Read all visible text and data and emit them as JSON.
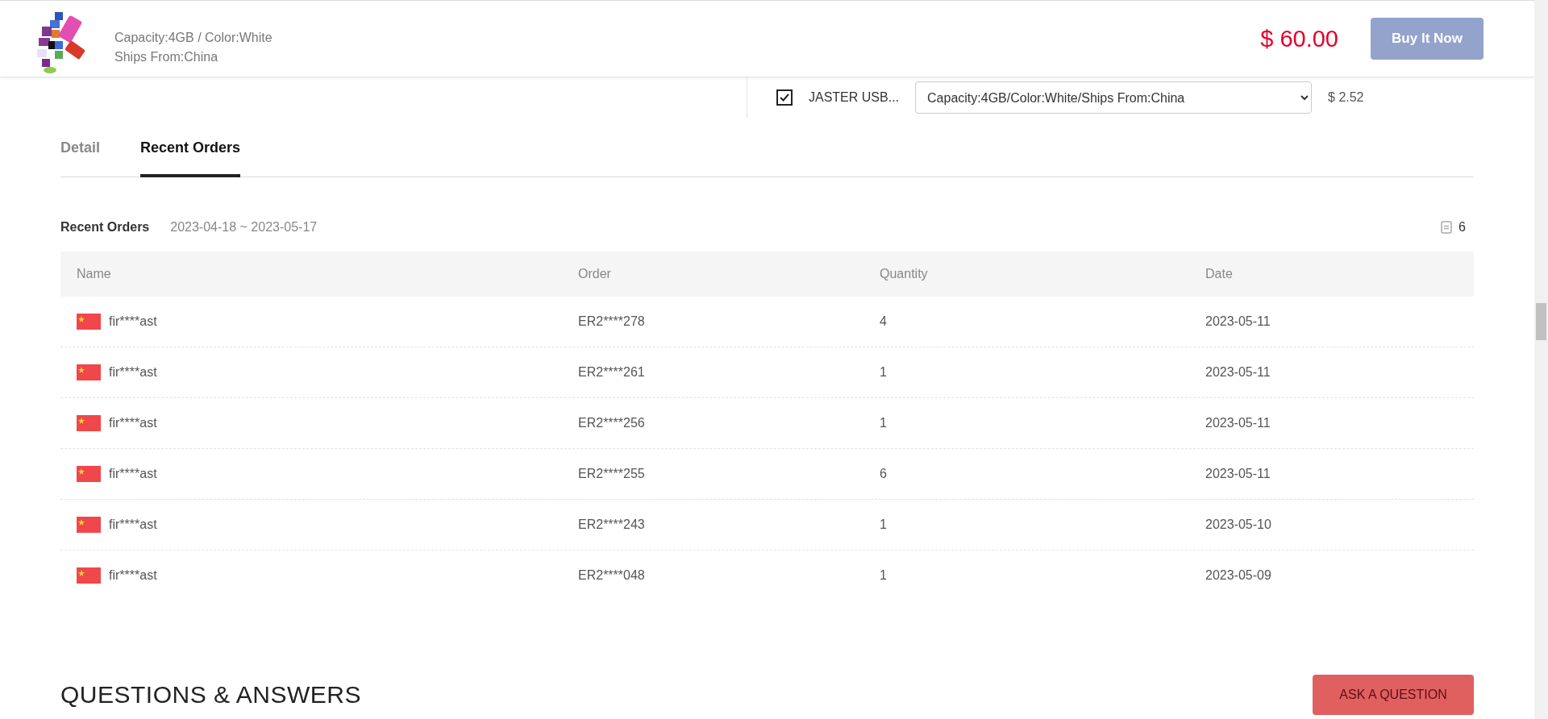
{
  "header": {
    "variant": "Capacity:4GB / Color:White",
    "shipping": "Ships From:China",
    "price": "$ 60.00",
    "buy_button": "Buy It Now"
  },
  "bundle_item": {
    "checked": true,
    "name": "JASTER USB...",
    "option": "Capacity:4GB/Color:White/Ships From:China",
    "price": "$ 2.52"
  },
  "tabs": [
    {
      "label": "Detail",
      "selected": false
    },
    {
      "label": "Recent Orders",
      "selected": true
    }
  ],
  "orders": {
    "title": "Recent Orders",
    "range": "2023-04-18 ~ 2023-05-17",
    "count": "6",
    "columns": [
      "Name",
      "Order",
      "Quantity",
      "Date"
    ],
    "rows": [
      {
        "name": "fir****ast",
        "order": "ER2****278",
        "quantity": "4",
        "date": "2023-05-11"
      },
      {
        "name": "fir****ast",
        "order": "ER2****261",
        "quantity": "1",
        "date": "2023-05-11"
      },
      {
        "name": "fir****ast",
        "order": "ER2****256",
        "quantity": "1",
        "date": "2023-05-11"
      },
      {
        "name": "fir****ast",
        "order": "ER2****255",
        "quantity": "6",
        "date": "2023-05-11"
      },
      {
        "name": "fir****ast",
        "order": "ER2****243",
        "quantity": "1",
        "date": "2023-05-10"
      },
      {
        "name": "fir****ast",
        "order": "ER2****048",
        "quantity": "1",
        "date": "2023-05-09"
      }
    ]
  },
  "questions": {
    "title": "QUESTIONS & ANSWERS",
    "button": "ASK A QUESTION"
  }
}
